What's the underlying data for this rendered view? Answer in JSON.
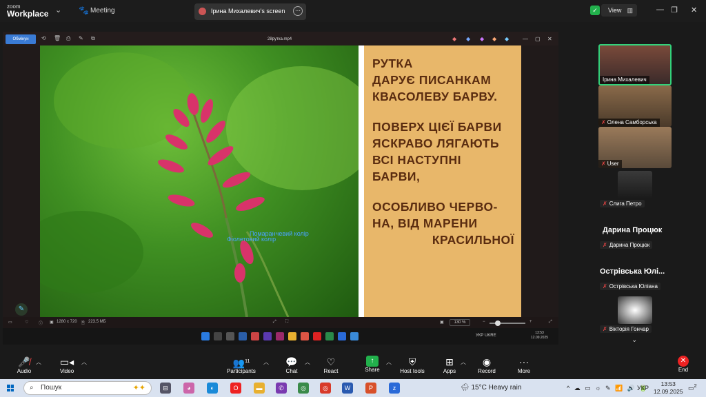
{
  "app": {
    "logo_line1": "zoom",
    "logo_line2": "Workplace",
    "meeting_label": "Meeting"
  },
  "tab": {
    "label": "Ірина Михалевич's screen"
  },
  "view_button": {
    "label": "View"
  },
  "share": {
    "open_with_label": "Обмінун",
    "filename": "28рутка.mp4",
    "overlay_text_1": "Помаранчевий колір",
    "overlay_text_2": "Фіолетовий колір",
    "slide_text": {
      "block1": [
        "РУТКА",
        "ДАРУЄ ПИСАНКАМ",
        "КВАСОЛЕВУ БАРВУ."
      ],
      "block2": [
        "ПОВЕРХ ЦІЄЇ БАРВИ",
        "ЯСКРАВО ЛЯГАЮТЬ",
        "ВСІ НАСТУПНІ",
        "БАРВИ,"
      ],
      "block3": [
        "ОСОБЛИВО ЧЕРВО-",
        "НА, ВІД МАРЕНИ"
      ],
      "block3_right": "КРАСИЛЬНОЇ"
    },
    "status": {
      "resolution": "1280 x 720",
      "size": "223.5 МБ",
      "zoom": "130 %"
    },
    "inner_tray": {
      "lang": "УКР UKRE",
      "time": "13:53",
      "date": "12.09.2025"
    }
  },
  "participants": {
    "tiles": [
      {
        "name": "Ірина Михалевич",
        "muted": false
      },
      {
        "name": "Олена Самборська",
        "muted": true
      },
      {
        "name": "User",
        "muted": true
      },
      {
        "name": "Слига Петро",
        "muted": true
      }
    ],
    "named": [
      {
        "big": "Дарина Процюк",
        "small": "Дарина Процюк"
      },
      {
        "big": "Острівська Юлі...",
        "small": "Острівська Юліана"
      }
    ],
    "last": {
      "name": "Вікторія Гончар"
    }
  },
  "toolbar": {
    "audio": "Audio",
    "video": "Video",
    "participants": "Participants",
    "participants_count": "11",
    "chat": "Chat",
    "react": "React",
    "share": "Share",
    "host_tools": "Host tools",
    "apps": "Apps",
    "record": "Record",
    "more": "More",
    "end": "End"
  },
  "taskbar": {
    "search_placeholder": "Пошук",
    "weather": "15°C  Heavy rain",
    "lang": "УКР",
    "time": "13:53",
    "date": "12.09.2025",
    "notif_count": "2"
  }
}
